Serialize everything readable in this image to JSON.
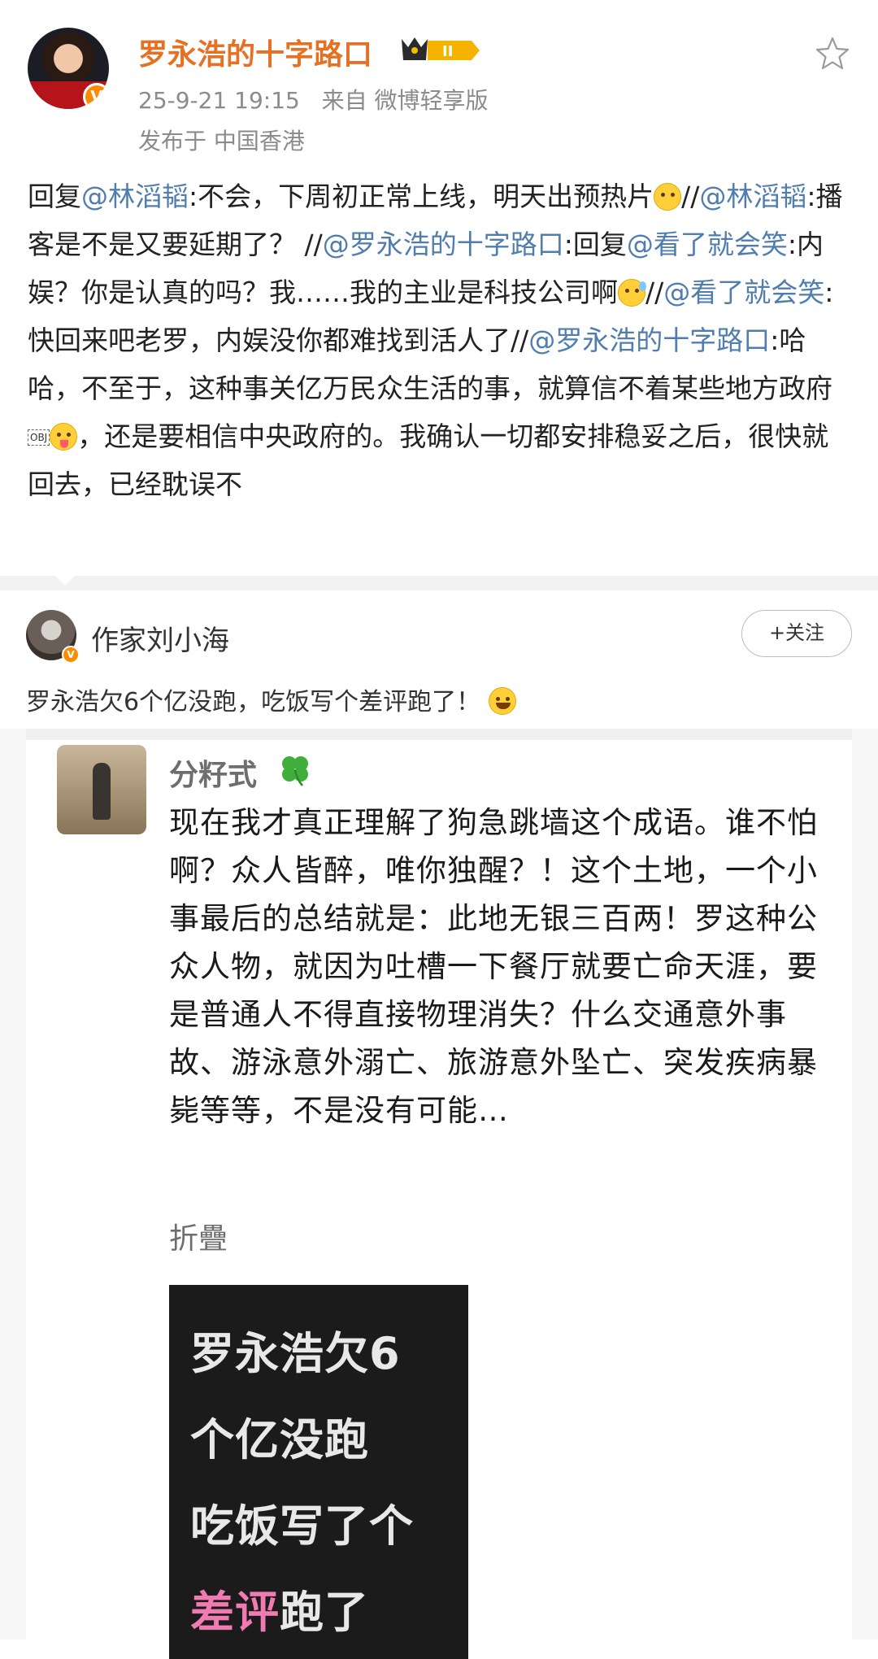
{
  "post": {
    "username": "罗永浩的十字路口",
    "level_badge": "II",
    "time": "25-9-21 19:15",
    "source": "来自 微博轻享版",
    "location": "发布于 中国香港",
    "content": {
      "t1": "回复",
      "m1": "@林滔韬",
      "t2": ":不会，下周初正常上线，明天出预热片",
      "t3": "//",
      "m2": "@林滔韬",
      "t4": ":播客是不是又要延期了？ //",
      "m3": "@罗永浩的十字路口",
      "t5": ":回复",
      "m4": "@看了就会笑",
      "t6": ":内娱？你是认真的吗？我……我的主业是科技公司啊",
      "t7": "//",
      "m5": "@看了就会笑",
      "t8": ":快回来吧老罗，内娱没你都难找到活人了//",
      "m6": "@罗永浩的十字路口",
      "t9": ":哈哈，不至于，这种事关亿万民众生活的事，就算信不着某些地方政府",
      "obj": "OBJ",
      "t10": "，还是要相信中央政府的。我确认一切都安排稳妥之后，很快就回去，已经耽误不"
    }
  },
  "comment": {
    "username": "作家刘小海",
    "follow_label": "+关注",
    "text": "罗永浩欠6个亿没跑，吃饭写个差评跑了！"
  },
  "screenshot": {
    "name": "分籽式",
    "body": "现在我才真正理解了狗急跳墙这个成语。谁不怕啊？众人皆醉，唯你独醒？！这个土地，一个小事最后的总结就是：此地无银三百两！罗这种公众人物，就因为吐槽一下餐厅就要亡命天涯，要是普通人不得直接物理消失？什么交通意外事故、游泳意外溺亡、旅游意外坠亡、突发疾病暴毙等等，不是没有可能…",
    "fold_label": "折疊",
    "image_text": {
      "l1": "罗永浩欠6",
      "l2": "个亿没跑",
      "l3": "吃饭写了个",
      "l4a": "差评",
      "l4b": "跑了"
    }
  },
  "colors": {
    "username": "#e57125",
    "mention": "#507daf",
    "meta": "#8b8b8b"
  },
  "icons": [
    "star-icon",
    "crown-badge-icon",
    "verified-icon",
    "clover-icon"
  ]
}
